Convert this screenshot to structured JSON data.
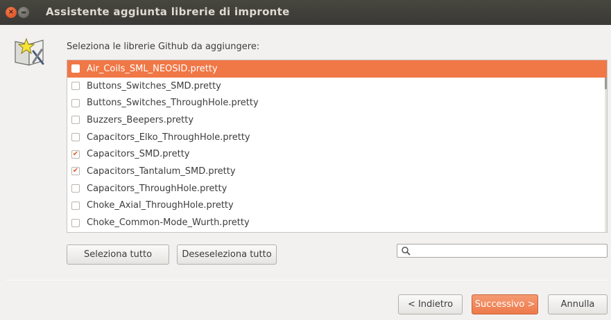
{
  "window": {
    "title": "Assistente aggiunta librerie di impronte",
    "close_glyph": "×",
    "min_glyph": "▬"
  },
  "prompt": "Seleziona le librerie Github da aggiungere:",
  "libraries": [
    {
      "name": "Air_Coils_SML_NEOSID.pretty",
      "checked": false,
      "selected": true
    },
    {
      "name": "Buttons_Switches_SMD.pretty",
      "checked": false,
      "selected": false
    },
    {
      "name": "Buttons_Switches_ThroughHole.pretty",
      "checked": false,
      "selected": false
    },
    {
      "name": "Buzzers_Beepers.pretty",
      "checked": false,
      "selected": false
    },
    {
      "name": "Capacitors_Elko_ThroughHole.pretty",
      "checked": false,
      "selected": false
    },
    {
      "name": "Capacitors_SMD.pretty",
      "checked": true,
      "selected": false
    },
    {
      "name": "Capacitors_Tantalum_SMD.pretty",
      "checked": true,
      "selected": false
    },
    {
      "name": "Capacitors_ThroughHole.pretty",
      "checked": false,
      "selected": false
    },
    {
      "name": "Choke_Axial_ThroughHole.pretty",
      "checked": false,
      "selected": false
    },
    {
      "name": "Choke_Common-Mode_Wurth.pretty",
      "checked": false,
      "selected": false
    }
  ],
  "buttons": {
    "select_all": "Seleziona tutto",
    "deselect_all": "Deseseleziona tutto",
    "back": "< Indietro",
    "next": "Successivo >",
    "cancel": "Annulla"
  },
  "search": {
    "value": "",
    "placeholder": "",
    "icon": "search-icon"
  },
  "colors": {
    "accent": "#f07746",
    "titlebar": "#3c3b37"
  }
}
